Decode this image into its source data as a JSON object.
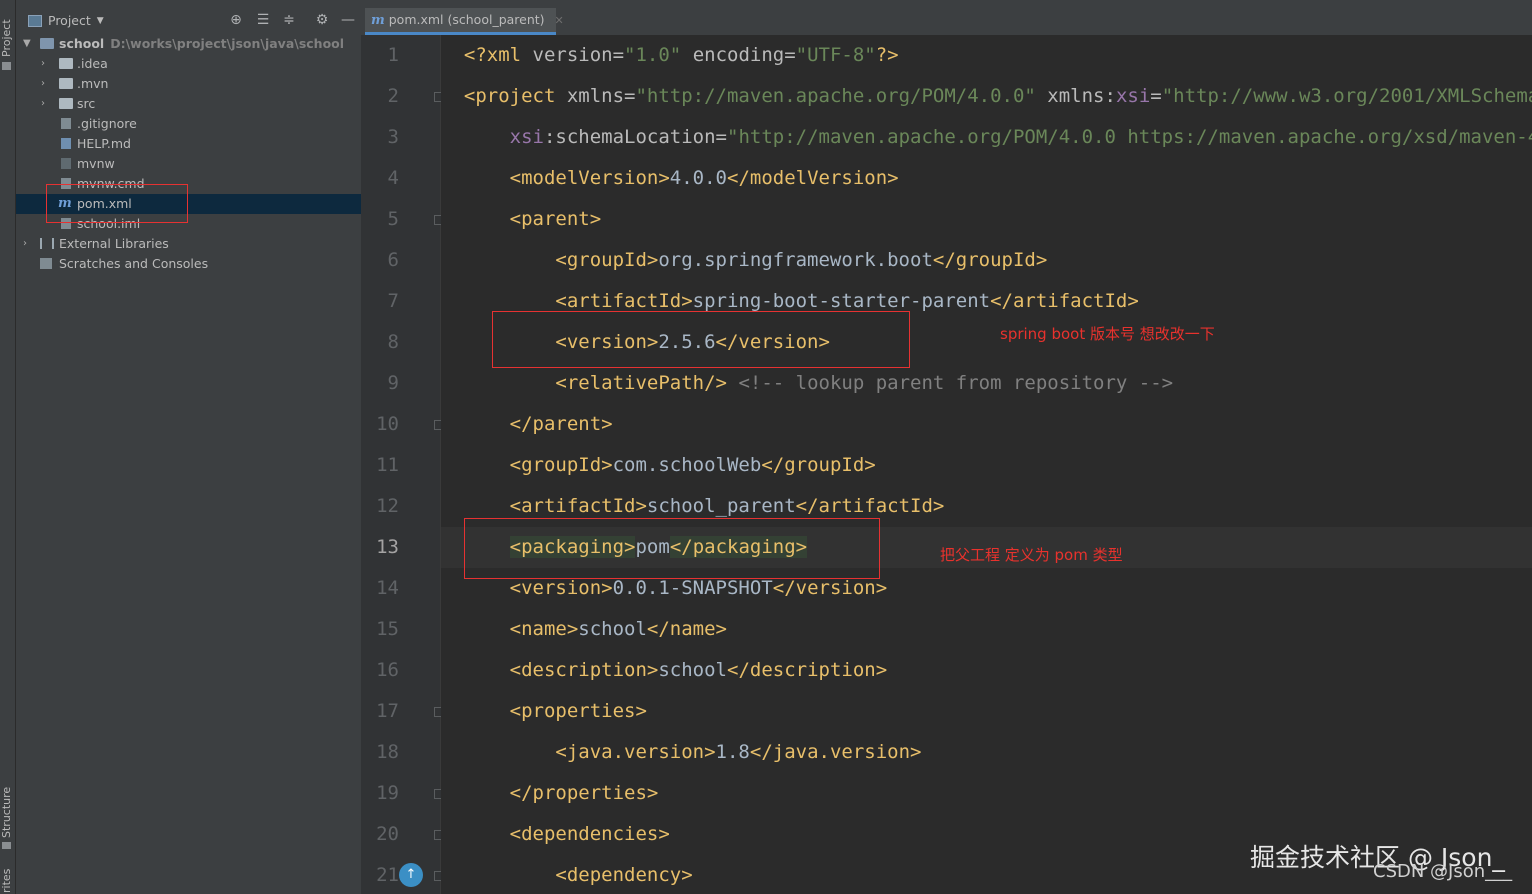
{
  "tool_strip": {
    "project_label": "Project",
    "structure_label": "Structure",
    "favorites_label": "rites"
  },
  "project_panel": {
    "title": "Project",
    "tree": [
      {
        "label": "school",
        "path": "D:\\works\\project\\json\\java\\school",
        "kind": "module",
        "expanded": true
      },
      {
        "label": ".idea",
        "kind": "folder"
      },
      {
        "label": ".mvn",
        "kind": "folder"
      },
      {
        "label": "src",
        "kind": "folder"
      },
      {
        "label": ".gitignore",
        "kind": "file"
      },
      {
        "label": "HELP.md",
        "kind": "file"
      },
      {
        "label": "mvnw",
        "kind": "file"
      },
      {
        "label": "mvnw.cmd",
        "kind": "file"
      },
      {
        "label": "pom.xml",
        "kind": "maven",
        "selected": true
      },
      {
        "label": "school.iml",
        "kind": "file"
      },
      {
        "label": "External Libraries",
        "kind": "library"
      },
      {
        "label": "Scratches and Consoles",
        "kind": "scratch"
      }
    ]
  },
  "editor": {
    "tab_label": "pom.xml (school_parent)",
    "current_line": 13,
    "line_numbers": [
      "1",
      "2",
      "3",
      "4",
      "5",
      "6",
      "7",
      "8",
      "9",
      "10",
      "11",
      "12",
      "13",
      "14",
      "15",
      "16",
      "17",
      "18",
      "19",
      "20",
      "21"
    ]
  },
  "annotations": {
    "version_note": "spring boot 版本号 想改改一下",
    "packaging_note": "把父工程 定义为 pom 类型"
  },
  "watermark": {
    "line1": "掘金技术社区 @ Json_",
    "line2": "CSDN @Json___"
  },
  "colors": {
    "tag": "#e8bf6a",
    "attr_value": "#6a8759",
    "namespace": "#9876aa",
    "comment": "#808080",
    "annotation": "#e8322d"
  }
}
